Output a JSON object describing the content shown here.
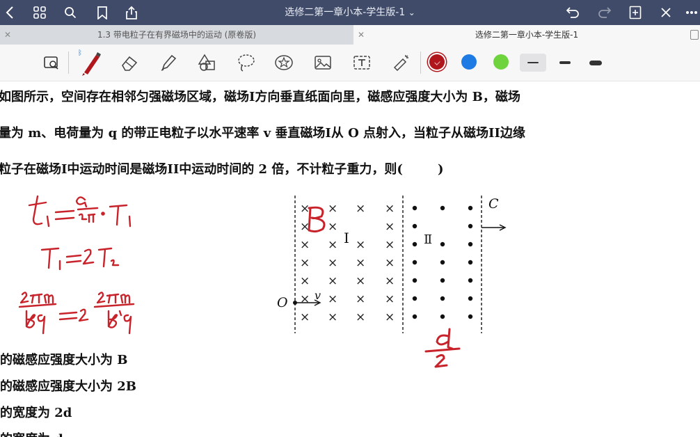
{
  "topbar": {
    "title": "选修二第一章小本-学生版-1",
    "title_chevron": "⌄",
    "icons": [
      "back-icon",
      "grid-icon",
      "search-icon",
      "bookmark-icon",
      "share-icon",
      "undo-icon",
      "redo-icon",
      "add-page-icon",
      "close-icon",
      "more-icon"
    ]
  },
  "tabs": [
    {
      "label": "1.3 带电粒子在有界磁场中的运动 (原卷版)",
      "active": false
    },
    {
      "label": "选修二第一章小本-学生版-1",
      "active": true
    }
  ],
  "toolbar": {
    "tools": [
      "lasso-zoom-icon",
      "pen-icon",
      "eraser-icon",
      "highlighter-icon",
      "shapes-icon",
      "lasso-icon",
      "sticker-icon",
      "image-icon",
      "textbox-icon",
      "laser-icon"
    ],
    "colors": [
      "#b0171c",
      "#1e7be3",
      "#6fd33e"
    ],
    "line_weights": [
      "thin",
      "medium",
      "thick"
    ]
  },
  "question": {
    "line1": "如图所示，空间存在相邻匀强磁场区域，磁场I方向垂直纸面向里，磁感应强度大小为 B，磁场",
    "line2": "量为 m、电荷量为 q 的带正电粒子以水平速率 v 垂直磁场I从 O 点射入，当粒子从磁场II边缘",
    "line3": "粒子在磁场I中运动时间是磁场II中运动时间的 2 倍，不计粒子重力，则(        )"
  },
  "figure": {
    "label_O": "O",
    "label_v": "v",
    "label_C": "C",
    "label_I": "I",
    "label_II": "Ⅱ",
    "cross": "×",
    "dot": "•"
  },
  "handwriting": {
    "eq1": "t₁ = α/2π · T₁",
    "eq2": "T₁ = 2T₂",
    "eq3": "2πm/Bq = 2 · 2πm/B′q",
    "field_B": "B",
    "width_note": "d/2"
  },
  "options": [
    "的磁感应强度大小为 B",
    "的磁感应强度大小为 2B",
    "的宽度为 2d",
    "的宽度为 d"
  ]
}
